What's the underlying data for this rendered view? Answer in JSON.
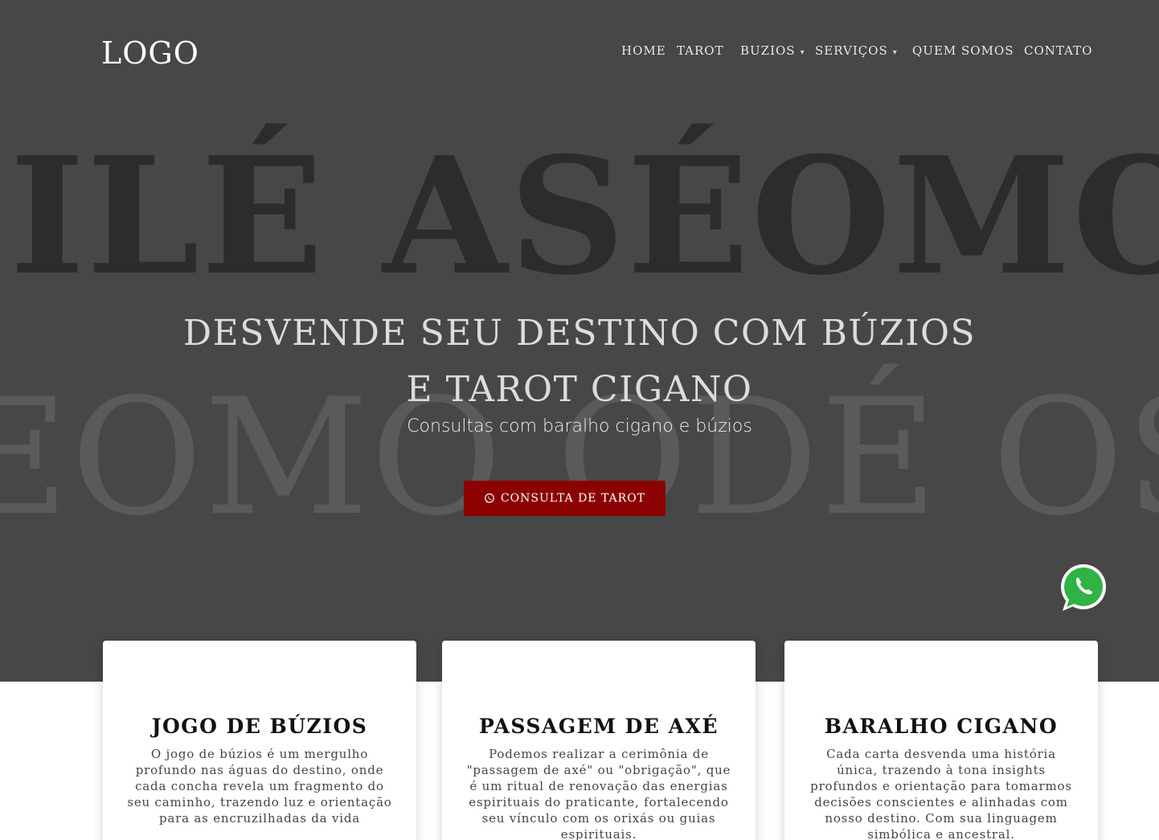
{
  "header": {
    "logo": "LOGO",
    "nav": [
      {
        "label": "HOME",
        "dropdown": false
      },
      {
        "label": "TAROT",
        "dropdown": false
      },
      {
        "label": "BUZIOS",
        "dropdown": true
      },
      {
        "label": "SERVIÇOS",
        "dropdown": true
      },
      {
        "label": "QUEM SOMOS",
        "dropdown": false
      },
      {
        "label": "CONTATO",
        "dropdown": false
      }
    ]
  },
  "hero": {
    "bg_text_row1": "ILÉ ASÉOMO O",
    "bg_text_row2": "EOMO ODÉ OSU",
    "title": "DESVENDE SEU DESTINO COM BÚZIOS E TAROT CIGANO",
    "subtitle": "Consultas com baralho cigano e búzios",
    "cta_label": "CONSULTA DE TAROT",
    "cta_icon": "whatsapp-icon"
  },
  "floating": {
    "icon": "whatsapp-icon"
  },
  "cards": [
    {
      "title": "JOGO DE BÚZIOS",
      "text": "O jogo de búzios é um mergulho profundo nas águas do destino, onde cada concha revela um fragmento do seu caminho, trazendo luz e orientação para as encruzilhadas da vida"
    },
    {
      "title": "PASSAGEM DE AXÉ",
      "text": "Podemos realizar a cerimônia de \"passagem de axé\" ou \"obrigação\", que é um ritual de renovação das energias espirituais do praticante, fortalecendo seu vínculo com os orixás ou guias espirituais."
    },
    {
      "title": "BARALHO CIGANO",
      "text": "Cada carta desvenda uma história única, trazendo à tona insights profundos e orientação para tomarmos decisões conscientes e alinhadas com nosso destino. Com sua linguagem simbólica e ancestral."
    }
  ],
  "colors": {
    "hero_bg": "#474747",
    "accent": "#8b0000",
    "whatsapp": "#2fb344"
  }
}
